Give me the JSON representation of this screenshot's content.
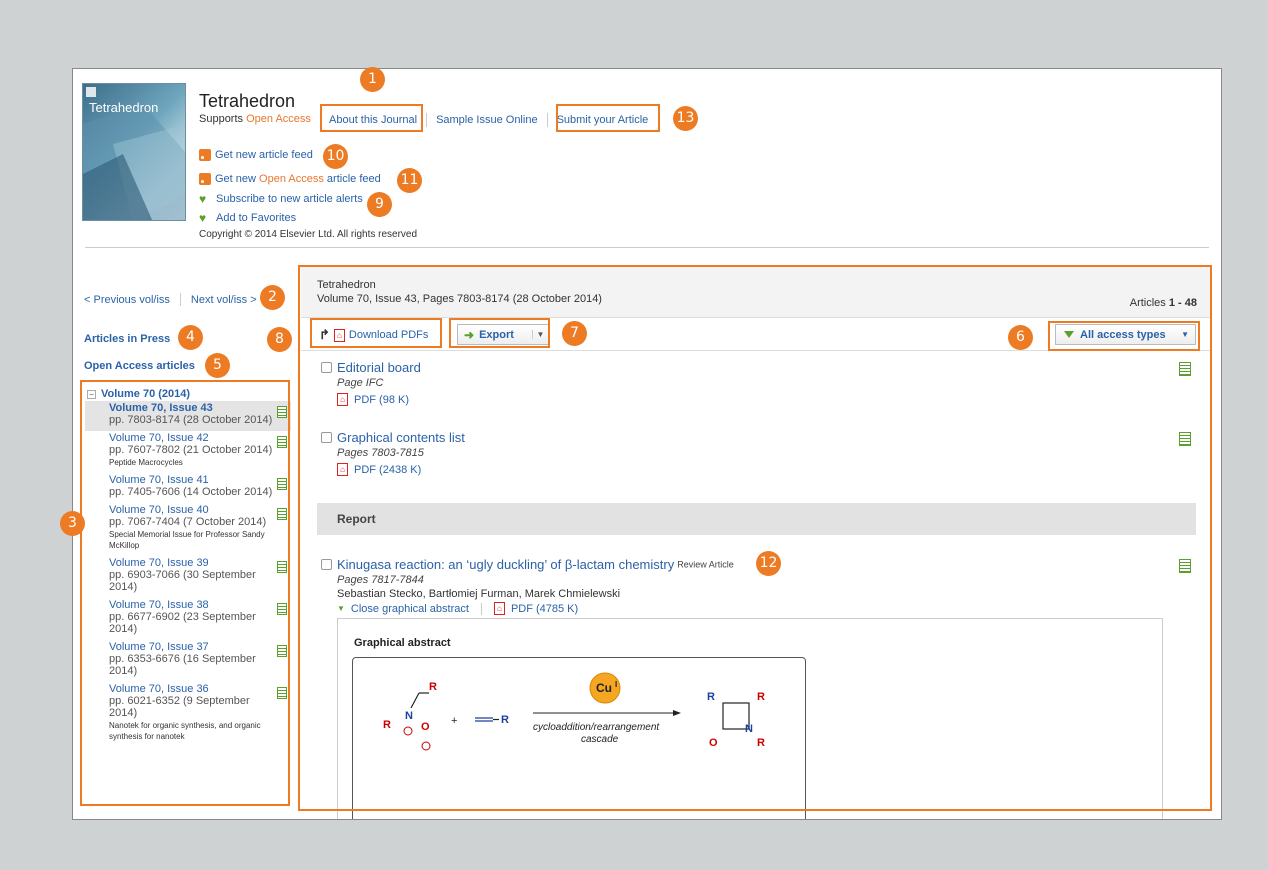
{
  "header": {
    "journal": "Tetrahedron",
    "cover_title": "Tetrahedron",
    "supports_prefix": "Supports ",
    "supports_oa": "Open Access",
    "nav": [
      "About this Journal",
      "Sample Issue Online",
      "Submit your Article"
    ],
    "feed1": "Get new article feed",
    "feed2_a": "Get new ",
    "feed2_oa": "Open Access",
    "feed2_b": " article feed",
    "alerts": "Subscribe to new article alerts",
    "favorites": "Add to Favorites",
    "copyright": "Copyright © 2014 Elsevier Ltd. All rights reserved"
  },
  "sidebar": {
    "prev": "< Previous vol/iss",
    "next": "Next vol/iss >",
    "press": "Articles in Press",
    "oa": "Open Access articles",
    "volume": "Volume 70 (2014)",
    "issues": [
      {
        "title": "Volume 70, Issue 43",
        "pages": "pp. 7803-8174 (28 October 2014)",
        "note": ""
      },
      {
        "title": "Volume 70, Issue 42",
        "pages": "pp. 7607-7802 (21 October 2014)",
        "note": "Peptide Macrocycles"
      },
      {
        "title": "Volume 70, Issue 41",
        "pages": "pp. 7405-7606 (14 October 2014)",
        "note": ""
      },
      {
        "title": "Volume 70, Issue 40",
        "pages": "pp. 7067-7404 (7 October 2014)",
        "note": "Special Memorial Issue for Professor Sandy McKillop"
      },
      {
        "title": "Volume 70, Issue 39",
        "pages": "pp. 6903-7066 (30 September 2014)",
        "note": ""
      },
      {
        "title": "Volume 70, Issue 38",
        "pages": "pp. 6677-6902 (23 September 2014)",
        "note": ""
      },
      {
        "title": "Volume 70, Issue 37",
        "pages": "pp. 6353-6676 (16 September 2014)",
        "note": ""
      },
      {
        "title": "Volume 70, Issue 36",
        "pages": "pp. 6021-6352 (9 September 2014)",
        "note": "Nanotek for organic synthesis, and organic synthesis for nanotek"
      }
    ]
  },
  "main": {
    "journal": "Tetrahedron",
    "volinfo": "Volume 70, Issue 43, Pages 7803-8174 (28 October 2014)",
    "articles_label": "Articles ",
    "articles_range": "1 - 48",
    "download": "Download PDFs",
    "export": "Export",
    "access": "All access types",
    "articles": [
      {
        "title": "Editorial board",
        "pages": "Page IFC",
        "pdf": "PDF (98 K)"
      },
      {
        "title": "Graphical contents list",
        "pages": "Pages 7803-7815",
        "pdf": "PDF (2438 K)"
      },
      {
        "title": "Kinugasa reaction: an ‘ugly duckling’ of β-lactam chemistry",
        "type": "Review Article",
        "pages": "Pages 7817-7844",
        "authors": "Sebastian Stecko, Bartłomiej Furman, Marek Chmielewski",
        "close": "Close graphical abstract",
        "pdf": "PDF (4785 K)"
      }
    ],
    "section": "Report",
    "ga_heading": "Graphical abstract",
    "scheme": {
      "catalyst": "Cu",
      "cat_sup": "I",
      "line1": "cycloaddition/rearrangement",
      "line2": "cascade",
      "R": "R",
      "N": "N",
      "O": "O",
      "plus": "+"
    }
  },
  "callouts": [
    "1",
    "2",
    "3",
    "4",
    "5",
    "6",
    "7",
    "8",
    "9",
    "10",
    "11",
    "12",
    "13"
  ],
  "colors": {
    "accent": "#ec7b24",
    "link": "#2a62a8",
    "green": "#5aa02c"
  }
}
